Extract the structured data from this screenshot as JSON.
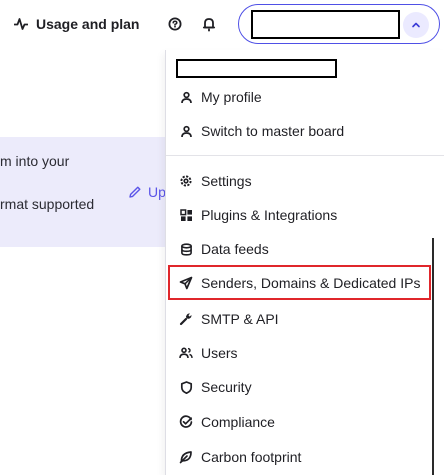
{
  "header": {
    "usage_label": "Usage and plan"
  },
  "banner": {
    "line1": "m into your",
    "line2": "rmat supported",
    "upload_label": "Up"
  },
  "menu": {
    "items": [
      {
        "label": "My profile",
        "icon": "user-icon"
      },
      {
        "label": "Switch to master board",
        "icon": "user-icon"
      },
      {
        "label": "Settings",
        "icon": "gear-icon"
      },
      {
        "label": "Plugins & Integrations",
        "icon": "grid-icon"
      },
      {
        "label": "Data feeds",
        "icon": "database-icon"
      },
      {
        "label": "Senders, Domains & Dedicated IPs",
        "icon": "send-icon",
        "highlighted": true
      },
      {
        "label": "SMTP & API",
        "icon": "wrench-icon"
      },
      {
        "label": "Users",
        "icon": "users-icon"
      },
      {
        "label": "Security",
        "icon": "shield-icon"
      },
      {
        "label": "Compliance",
        "icon": "check-circle-icon"
      },
      {
        "label": "Carbon footprint",
        "icon": "leaf-icon"
      }
    ]
  },
  "colors": {
    "accent": "#4f50e6",
    "highlight_border": "#e0262b",
    "banner_bg": "#ecebfb",
    "link": "#5b55e8"
  }
}
